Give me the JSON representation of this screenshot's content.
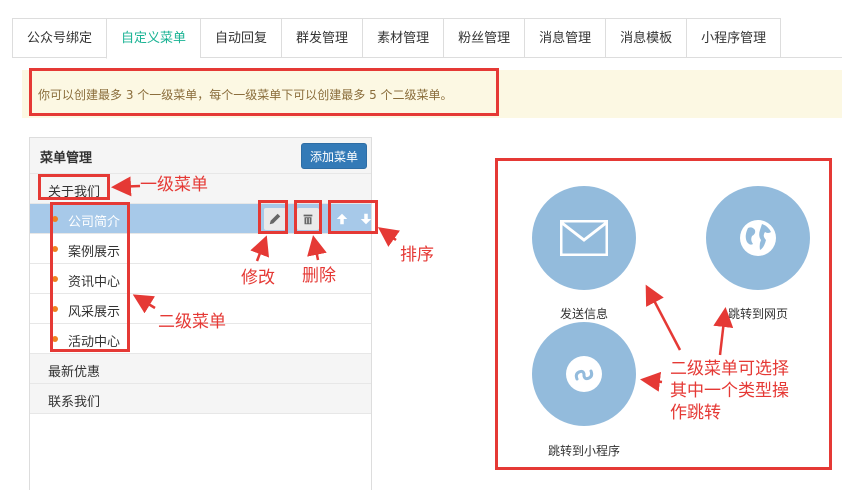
{
  "tabs": [
    "公众号绑定",
    "自定义菜单",
    "自动回复",
    "群发管理",
    "素材管理",
    "粉丝管理",
    "消息管理",
    "消息模板",
    "小程序管理"
  ],
  "active_tab_index": 1,
  "notice": "你可以创建最多 3 个一级菜单，每个一级菜单下可以创建最多 5 个二级菜单。",
  "menu": {
    "title": "菜单管理",
    "add_button": "添加菜单",
    "level1_first": "关于我们",
    "level2": [
      "公司简介",
      "案例展示",
      "资讯中心",
      "风采展示",
      "活动中心"
    ],
    "level1_rest": [
      "最新优惠",
      "联系我们"
    ]
  },
  "types": {
    "send_message": "发送信息",
    "jump_web": "跳转到网页",
    "jump_miniprogram": "跳转到小程序"
  },
  "annotations": {
    "level1": "一级菜单",
    "level2": "二级菜单",
    "edit": "修改",
    "delete": "删除",
    "sort": "排序",
    "types_l1": "二级菜单可选择",
    "types_l2": "其中一个类型操",
    "types_l3": "作跳转"
  },
  "colors": {
    "accent_tab": "#1ab394",
    "annotation_red": "#e53935",
    "selected_row": "#a7c9e9",
    "circle_blue": "#93bbdc",
    "primary_button": "#337ab7",
    "notice_bg": "#fcf8e3",
    "notice_text": "#8a6d3b",
    "bullet": "#f08020"
  }
}
